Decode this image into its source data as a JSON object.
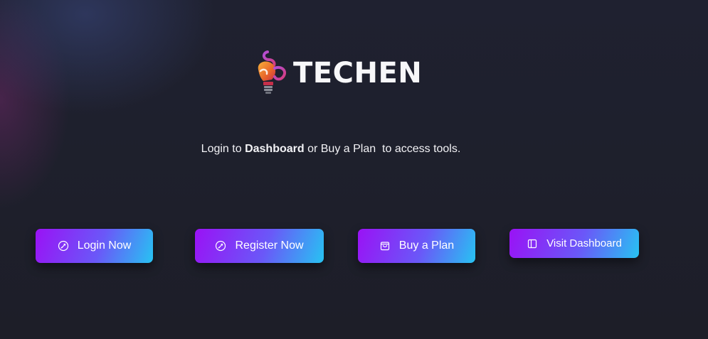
{
  "brand": {
    "name": "TECHEN",
    "logo_icon": "lightbulb-logo-icon"
  },
  "tagline": {
    "prefix": "Login to ",
    "bold": "Dashboard",
    "suffix": " or Buy a Plan  to access tools."
  },
  "buttons": {
    "login": {
      "label": "Login Now",
      "icon": "rocket-icon"
    },
    "register": {
      "label": "Register Now",
      "icon": "rocket-icon"
    },
    "buy": {
      "label": "Buy a Plan",
      "icon": "shopping-bag-icon"
    },
    "dashboard": {
      "label": "Visit Dashboard",
      "icon": "sidebar-layout-icon"
    }
  },
  "colors": {
    "background": "#1e1f29",
    "button_gradient_start": "#9a12f5",
    "button_gradient_end": "#27c3f2",
    "text": "#ffffff"
  }
}
